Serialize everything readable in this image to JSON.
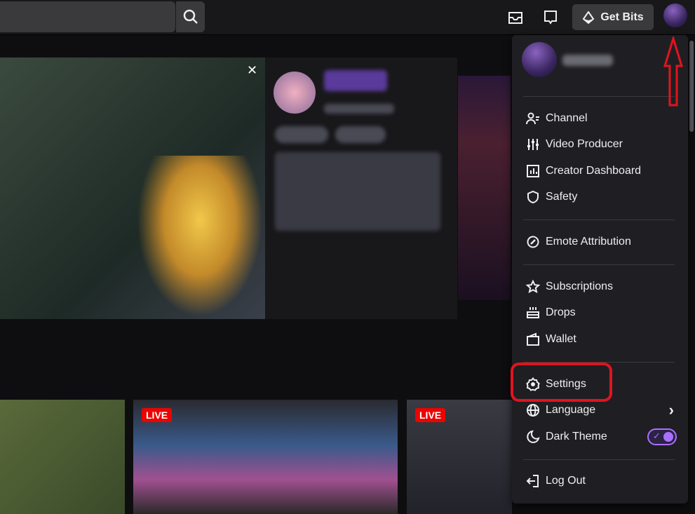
{
  "topbar": {
    "get_bits_label": "Get Bits",
    "icons": [
      "search-icon",
      "inbox-icon",
      "whispers-icon",
      "bits-icon",
      "avatar"
    ]
  },
  "thumbnails": [
    {
      "live": ""
    },
    {
      "live": "LIVE"
    },
    {
      "live": "LIVE"
    }
  ],
  "menu": {
    "groups": [
      [
        {
          "label": "Channel",
          "icon": "channel-icon"
        },
        {
          "label": "Video Producer",
          "icon": "sliders-icon"
        },
        {
          "label": "Creator Dashboard",
          "icon": "dashboard-icon"
        },
        {
          "label": "Safety",
          "icon": "shield-icon"
        }
      ],
      [
        {
          "label": "Emote Attribution",
          "icon": "emote-icon"
        }
      ],
      [
        {
          "label": "Subscriptions",
          "icon": "star-icon"
        },
        {
          "label": "Drops",
          "icon": "drops-icon"
        },
        {
          "label": "Wallet",
          "icon": "wallet-icon"
        }
      ],
      [
        {
          "label": "Settings",
          "icon": "gear-icon"
        },
        {
          "label": "Language",
          "icon": "globe-icon"
        },
        {
          "label": "Dark Theme",
          "icon": "moon-icon"
        }
      ],
      [
        {
          "label": "Log Out",
          "icon": "logout-icon"
        }
      ]
    ],
    "dark_theme_enabled": true
  },
  "annotation_color": "#e0141e"
}
